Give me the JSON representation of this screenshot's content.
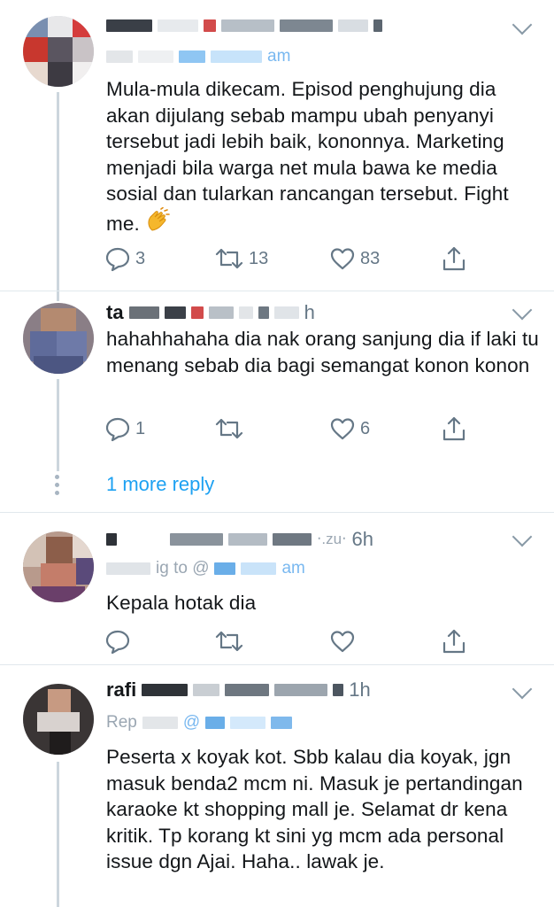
{
  "tweets": [
    {
      "time": "",
      "reply_fragment": "",
      "reply_handle": "am",
      "body": "Mula-mula dikecam. Episod penghujung dia akan dijulang sebab mampu ubah penyanyi tersebut jadi lebih baik, kononnya. Marketing menjadi bila warga net mula bawa ke media sosial dan tularkan rancangan tersebut. Fight me.",
      "emoji": "clapping-hands",
      "replies": "3",
      "retweets": "13",
      "likes": "83"
    },
    {
      "handle_fragment": "ta",
      "time": "h",
      "body": "hahahhahaha dia nak orang sanjung dia if laki tu menang sebab dia bagi semangat konon konon",
      "replies": "1",
      "retweets": "",
      "likes": "6"
    },
    {
      "time": "6h",
      "time_prefix": "‧.zu‧",
      "reply_fragment": "ig to @",
      "reply_handle": "am",
      "body": "Kepala hotak dia",
      "replies": "",
      "retweets": "",
      "likes": ""
    },
    {
      "handle_fragment": "rafi",
      "time": "1h",
      "reply_fragment": "Rep",
      "reply_handle": "@",
      "body": "Peserta x koyak kot. Sbb kalau dia koyak, jgn masuk benda2 mcm ni. Masuk je pertandingan karaoke kt shopping mall je. Selamat dr kena kritik. Tp korang kt sini yg mcm ada personal issue dgn Ajai. Haha.. lawak je.",
      "replies": "",
      "retweets": "",
      "likes": ""
    }
  ],
  "more_replies_label": "1 more reply",
  "colors": {
    "text": "#14171a",
    "secondary": "#657786",
    "link": "#1da1f2",
    "divider": "#e1e8ed"
  },
  "icons": [
    "reply-icon",
    "retweet-icon",
    "like-icon",
    "share-icon",
    "chevron-down-icon",
    "clapping-hands-emoji"
  ]
}
